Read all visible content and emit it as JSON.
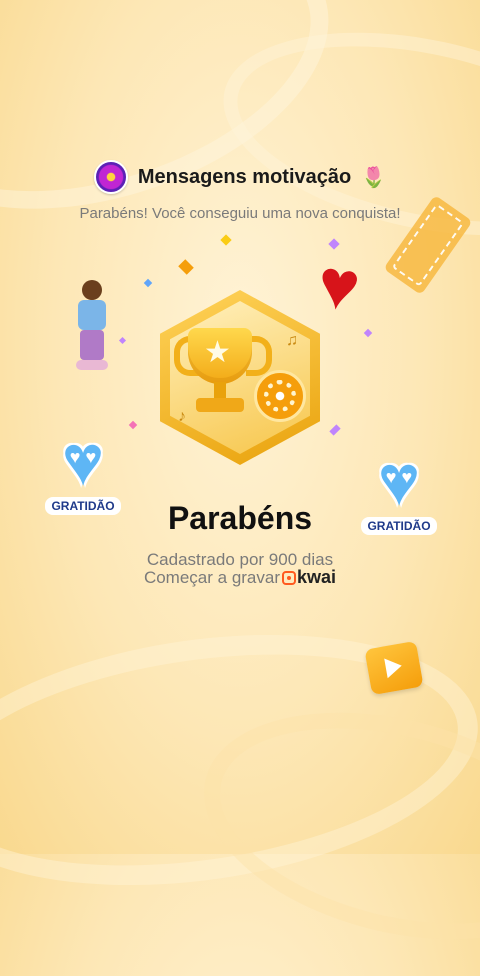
{
  "header": {
    "title": "Mensagens motivação",
    "avatar_icon": "purple-flower-avatar",
    "title_emoji": "🌷"
  },
  "subtitle": "Parabéns! Você conseguiu uma nova conquista!",
  "badge": {
    "icons": [
      "trophy-icon",
      "film-reel-icon",
      "star-icon"
    ]
  },
  "stickers": {
    "left_label": "GRATIDÃO",
    "right_label": "GRATIDÃO"
  },
  "achievement": {
    "title": "Parabéns",
    "days_text": "Cadastrado por 900 dias",
    "record_text": "Começar a gravar",
    "brand": "kwai"
  },
  "colors": {
    "background": "#fde7b5",
    "heart": "#d7141a",
    "sticker_heart": "#5eb6f5",
    "brand_orange": "#ff5a1f"
  }
}
